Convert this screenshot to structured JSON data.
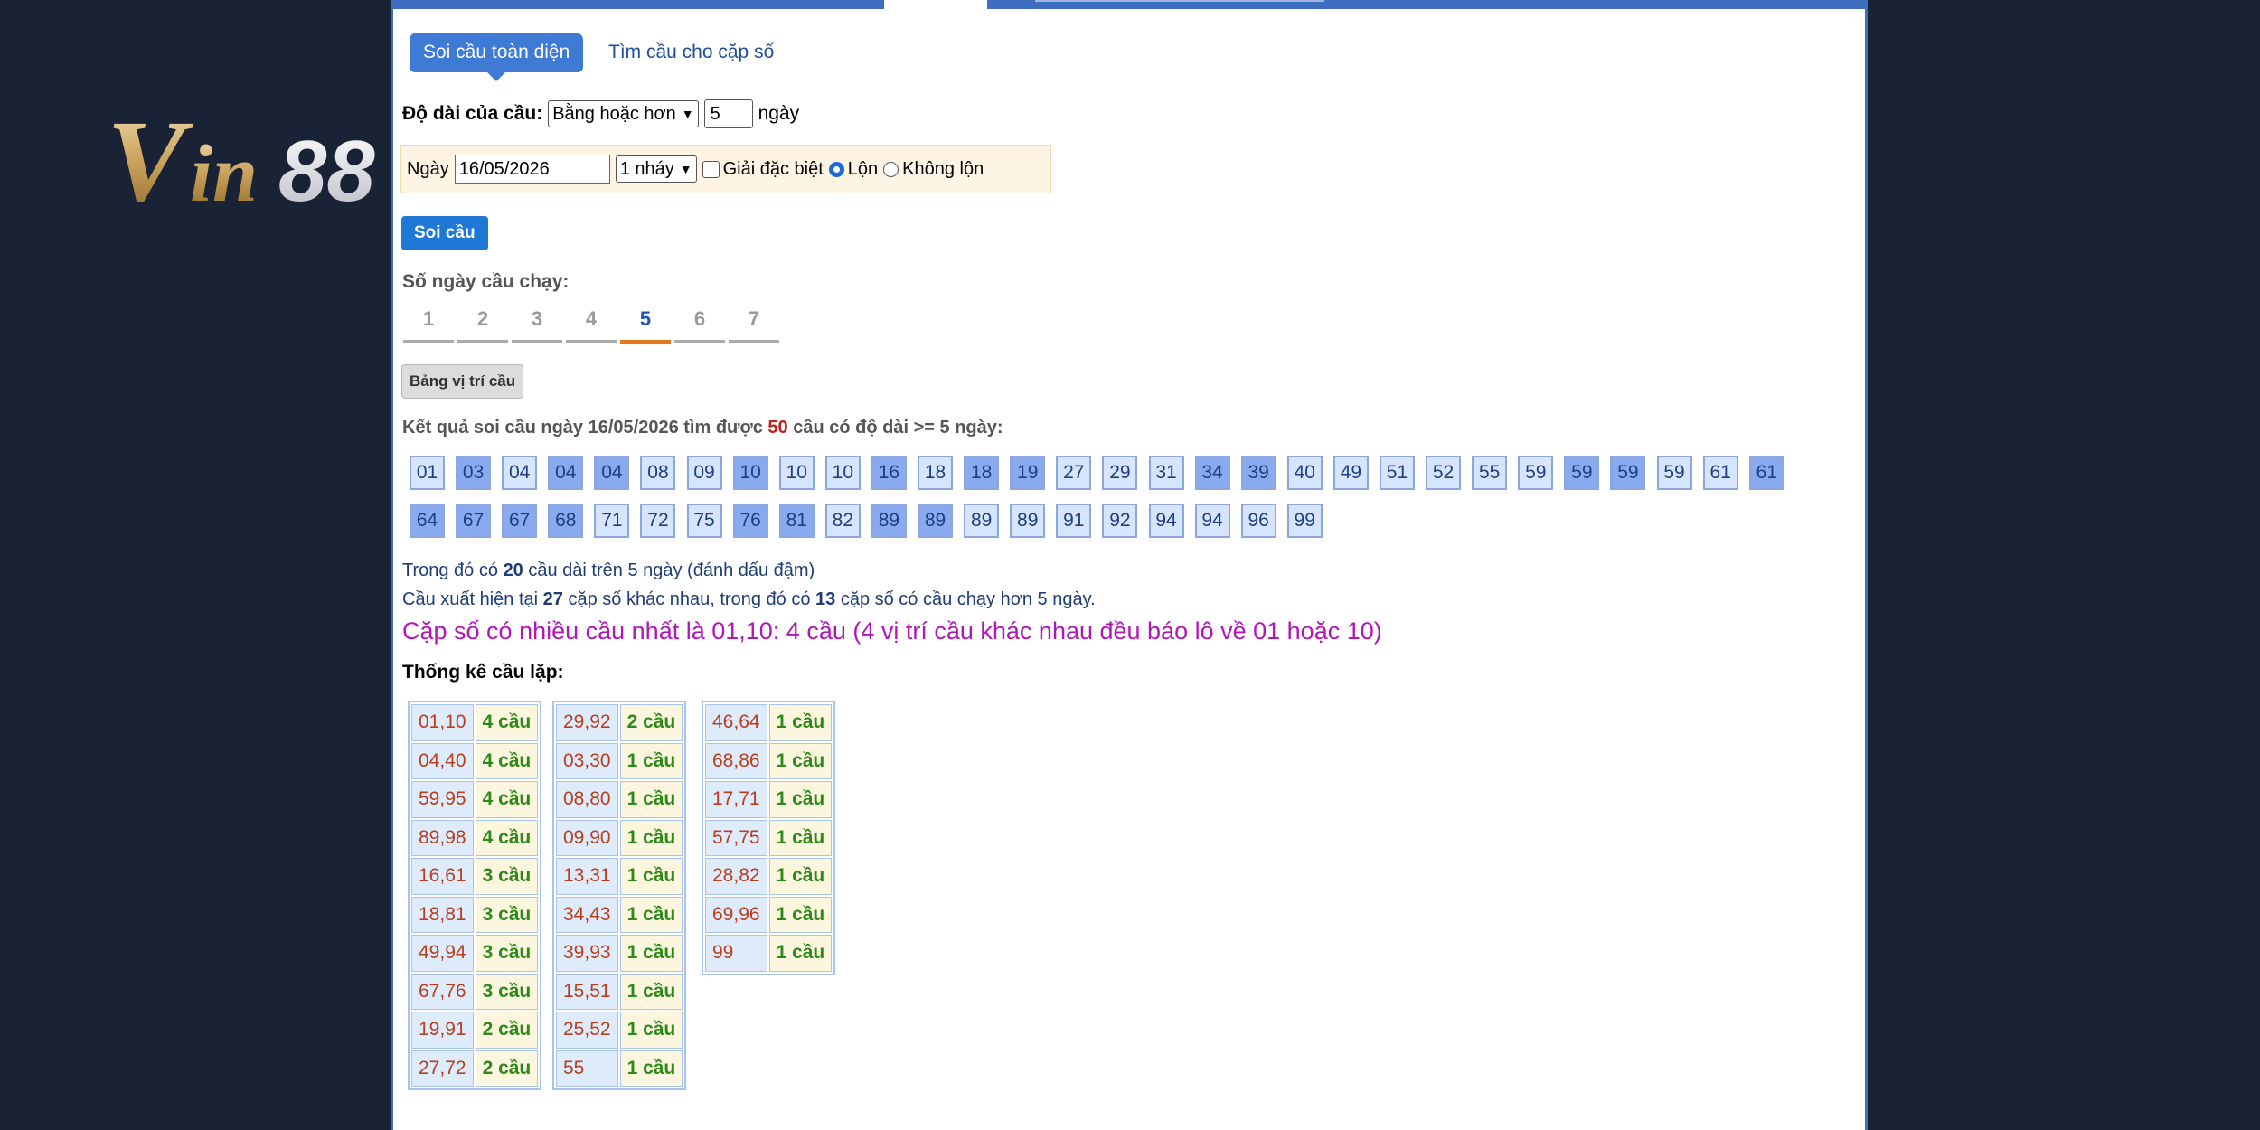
{
  "logo": {
    "text": "Vin88"
  },
  "tabs": {
    "active": "Soi cầu toàn diện",
    "other": "Tìm cầu cho cặp số"
  },
  "form": {
    "length_label": "Độ dài của cầu:",
    "length_mode": "Bằng hoặc hơn",
    "length_value": "5",
    "length_unit": "ngày",
    "date_label": "Ngày",
    "date_value": "16/05/2026",
    "jump_value": "1 nháy",
    "special_label": "Giải đặc biệt",
    "special_checked": false,
    "opt_lon": "Lộn",
    "opt_khong_lon": "Không lộn",
    "selected_option": "Lộn",
    "submit_label": "Soi cầu"
  },
  "days": {
    "label": "Số ngày cầu chạy:",
    "items": [
      "1",
      "2",
      "3",
      "4",
      "5",
      "6",
      "7"
    ],
    "active": "5"
  },
  "bang_button": "Bảng vị trí cầu",
  "result": {
    "prefix": "Kết quả soi cầu ngày 16/05/2026 tìm được",
    "count": "50",
    "suffix": "cầu có độ dài >= 5 ngày:"
  },
  "chips_row1": [
    {
      "n": "01",
      "b": false
    },
    {
      "n": "03",
      "b": true
    },
    {
      "n": "04",
      "b": false
    },
    {
      "n": "04",
      "b": true
    },
    {
      "n": "04",
      "b": true
    },
    {
      "n": "08",
      "b": false
    },
    {
      "n": "09",
      "b": false
    },
    {
      "n": "10",
      "b": true
    },
    {
      "n": "10",
      "b": false
    },
    {
      "n": "10",
      "b": false
    },
    {
      "n": "16",
      "b": true
    },
    {
      "n": "18",
      "b": false
    },
    {
      "n": "18",
      "b": true
    },
    {
      "n": "19",
      "b": true
    },
    {
      "n": "27",
      "b": false
    },
    {
      "n": "29",
      "b": false
    },
    {
      "n": "31",
      "b": false
    },
    {
      "n": "34",
      "b": true
    },
    {
      "n": "39",
      "b": true
    },
    {
      "n": "40",
      "b": false
    },
    {
      "n": "49",
      "b": false
    },
    {
      "n": "51",
      "b": false
    },
    {
      "n": "52",
      "b": false
    },
    {
      "n": "55",
      "b": false
    },
    {
      "n": "59",
      "b": false
    },
    {
      "n": "59",
      "b": true
    },
    {
      "n": "59",
      "b": true
    },
    {
      "n": "59",
      "b": false
    },
    {
      "n": "61",
      "b": false
    },
    {
      "n": "61",
      "b": true
    }
  ],
  "chips_row2": [
    {
      "n": "64",
      "b": true
    },
    {
      "n": "67",
      "b": true
    },
    {
      "n": "67",
      "b": true
    },
    {
      "n": "68",
      "b": true
    },
    {
      "n": "71",
      "b": false
    },
    {
      "n": "72",
      "b": false
    },
    {
      "n": "75",
      "b": false
    },
    {
      "n": "76",
      "b": true
    },
    {
      "n": "81",
      "b": true
    },
    {
      "n": "82",
      "b": false
    },
    {
      "n": "89",
      "b": true
    },
    {
      "n": "89",
      "b": true
    },
    {
      "n": "89",
      "b": false
    },
    {
      "n": "89",
      "b": false
    },
    {
      "n": "91",
      "b": false
    },
    {
      "n": "92",
      "b": false
    },
    {
      "n": "94",
      "b": false
    },
    {
      "n": "94",
      "b": false
    },
    {
      "n": "96",
      "b": false
    },
    {
      "n": "99",
      "b": false
    }
  ],
  "info1": {
    "a": "Trong đó có",
    "n": "20",
    "b": "cầu dài trên 5 ngày (đánh dấu đậm)"
  },
  "info2": {
    "a": "Cầu xuất hiện tại",
    "n1": "27",
    "b": "cặp số khác nhau, trong đó có",
    "n2": "13",
    "c": "cặp số có cầu chạy hơn 5 ngày."
  },
  "hot_line": "Cặp số có nhiều cầu nhất là 01,10: 4 cầu (4 vị trí cầu khác nhau đều báo lô về 01 hoặc 10)",
  "stats_title": "Thống kê cầu lặp:",
  "stats": [
    [
      [
        "01,10",
        "4 cầu"
      ],
      [
        "04,40",
        "4 cầu"
      ],
      [
        "59,95",
        "4 cầu"
      ],
      [
        "89,98",
        "4 cầu"
      ],
      [
        "16,61",
        "3 cầu"
      ],
      [
        "18,81",
        "3 cầu"
      ],
      [
        "49,94",
        "3 cầu"
      ],
      [
        "67,76",
        "3 cầu"
      ],
      [
        "19,91",
        "2 cầu"
      ],
      [
        "27,72",
        "2 cầu"
      ]
    ],
    [
      [
        "29,92",
        "2 cầu"
      ],
      [
        "03,30",
        "1 cầu"
      ],
      [
        "08,80",
        "1 cầu"
      ],
      [
        "09,90",
        "1 cầu"
      ],
      [
        "13,31",
        "1 cầu"
      ],
      [
        "34,43",
        "1 cầu"
      ],
      [
        "39,93",
        "1 cầu"
      ],
      [
        "15,51",
        "1 cầu"
      ],
      [
        "25,52",
        "1 cầu"
      ],
      [
        "55",
        "1 cầu"
      ]
    ],
    [
      [
        "46,64",
        "1 cầu"
      ],
      [
        "68,86",
        "1 cầu"
      ],
      [
        "17,71",
        "1 cầu"
      ],
      [
        "57,75",
        "1 cầu"
      ],
      [
        "28,82",
        "1 cầu"
      ],
      [
        "69,96",
        "1 cầu"
      ],
      [
        "99",
        "1 cầu"
      ]
    ]
  ]
}
